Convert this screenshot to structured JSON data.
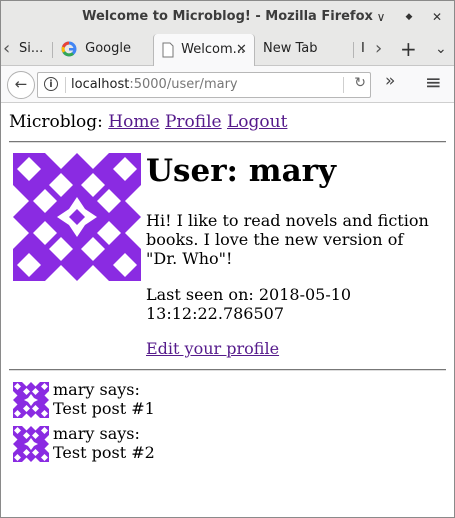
{
  "window": {
    "title": "Welcome to Microblog! - Mozilla Firefox",
    "minimize_glyph": "∨",
    "maximize_glyph": "◆",
    "close_glyph": "✕"
  },
  "tabs": [
    {
      "label": "Si...",
      "icon": "firefox-tab-icon"
    },
    {
      "label": "Google",
      "icon": "google-icon"
    },
    {
      "label": "Welcom...",
      "icon": "document-icon",
      "active": true
    },
    {
      "label": "New Tab",
      "icon": ""
    },
    {
      "label": "I",
      "icon": ""
    }
  ],
  "tabbar": {
    "scroll_left_glyph": "‹",
    "scroll_right_glyph": "›",
    "new_tab_glyph": "+",
    "list_glyph": "⌄",
    "close_glyph": "✕"
  },
  "navbar": {
    "back_glyph": "←",
    "info_glyph": "i",
    "url_host": "localhost",
    "url_rest": ":5000/user/mary",
    "reload_glyph": "↻",
    "overflow_glyph": "»",
    "menu_glyph": "≡"
  },
  "page": {
    "brand": "Microblog:",
    "nav_links": [
      "Home",
      "Profile",
      "Logout"
    ],
    "user_heading": "User: mary",
    "about_me": "Hi! I like to read novels and fiction books. I love the new version of \"Dr. Who\"!",
    "last_seen": "Last seen on: 2018-05-10 13:12:22.786507",
    "edit_profile": "Edit your profile",
    "posts": [
      {
        "author_line": "mary says:",
        "body": "Test post #1"
      },
      {
        "author_line": "mary says:",
        "body": "Test post #2"
      }
    ]
  },
  "colors": {
    "avatar_purple": "#8a2be2",
    "link_visited": "#551a8b",
    "chrome_bg": "#e8e8e7"
  }
}
